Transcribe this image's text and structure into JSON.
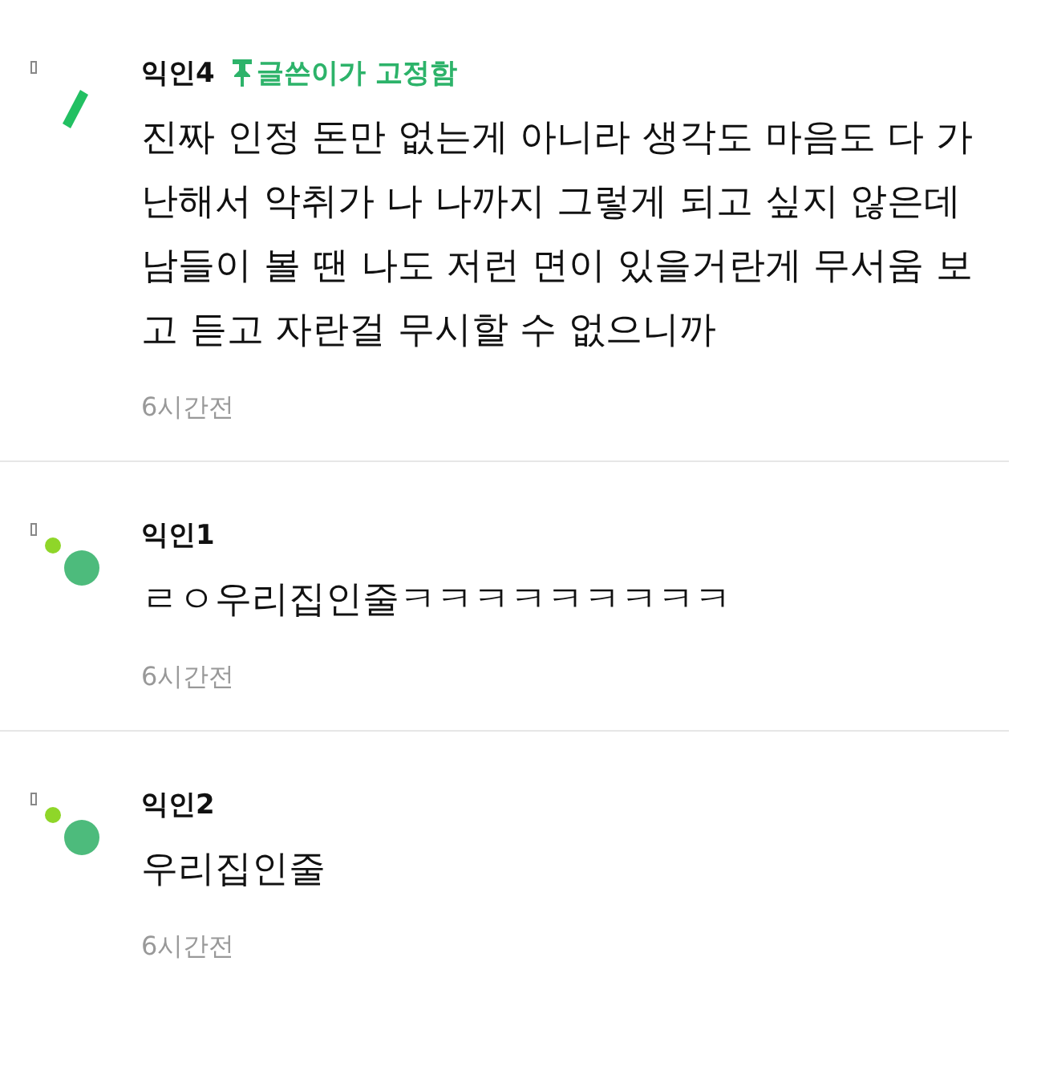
{
  "comments": [
    {
      "avatar": {
        "kind": "slash"
      },
      "author": "익인4",
      "pinned_badge": "글쓴이가 고정함",
      "text": "진짜 인정 돈만 없는게 아니라 생각도 마음도 다 가난해서 악취가 나 나까지 그렇게 되고 싶지 않은데 남들이 볼 땐 나도 저런 면이 있을거란게 무서움 보고 듣고 자란걸 무시할 수 없으니까",
      "time": "6시간전"
    },
    {
      "avatar": {
        "kind": "dots"
      },
      "author": "익인1",
      "text": "ㄹㅇ우리집인줄ㅋㅋㅋㅋㅋㅋㅋㅋㅋ",
      "time": "6시간전"
    },
    {
      "avatar": {
        "kind": "dots"
      },
      "author": "익인2",
      "text": "우리집인줄",
      "time": "6시간전"
    }
  ]
}
